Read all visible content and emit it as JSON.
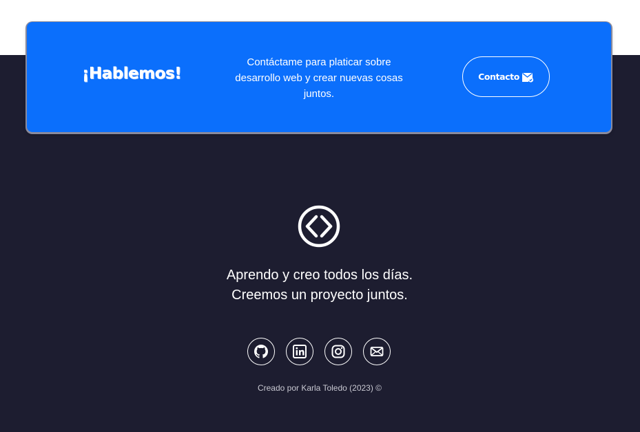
{
  "cta": {
    "title": "¡Hablemos!",
    "text": "Contáctame para platicar sobre desarrollo web y crear nuevas cosas juntos.",
    "button_label": "Contacto",
    "button_icon": "envelope-check-icon"
  },
  "footer": {
    "logo_icon": "code-diamond-icon",
    "tagline_line1": "Aprendo y creo todos los días.",
    "tagline_line2": "Creemos un proyecto juntos.",
    "socials": [
      "github-icon",
      "linkedin-icon",
      "instagram-icon",
      "mail-icon"
    ],
    "credit": "Creado por Karla Toledo (2023) ©"
  },
  "colors": {
    "accent": "#0b6ffc",
    "footer_bg": "#1d1d30",
    "text": "#ffffff"
  }
}
